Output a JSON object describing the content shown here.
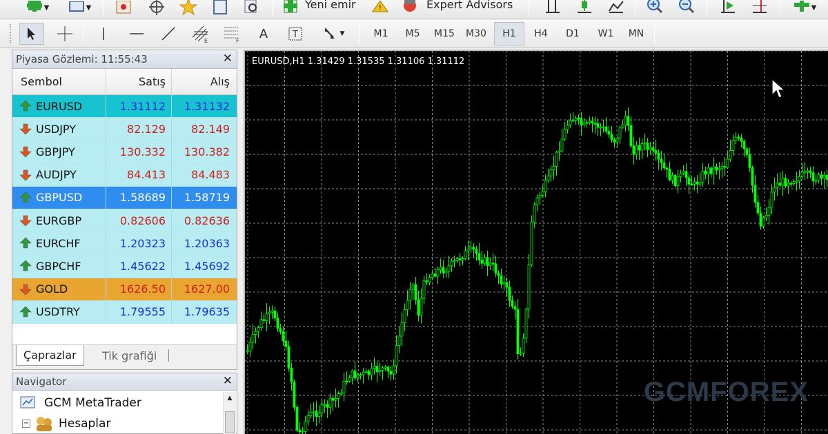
{
  "toolbar": {
    "new_order_label": "Yeni emir",
    "expert_advisors_label": "Expert Advisors",
    "timeframes": [
      "M1",
      "M5",
      "M15",
      "M30",
      "H1",
      "H4",
      "D1",
      "W1",
      "MN"
    ],
    "active_timeframe": "H1",
    "text_tool_label": "A"
  },
  "market_watch": {
    "title": "Piyasa Gözlemi: 11:55:43",
    "headers": {
      "symbol": "Sembol",
      "bid": "Satış",
      "ask": "Alış"
    },
    "rows": [
      {
        "symbol": "EURUSD",
        "bid": "1.31112",
        "ask": "1.31132",
        "direction": "up",
        "bg": "#17c3cf",
        "color": "#1530d0"
      },
      {
        "symbol": "USDJPY",
        "bid": "82.129",
        "ask": "82.149",
        "direction": "down",
        "bg": "#b7ecf3",
        "color": "#d0201a"
      },
      {
        "symbol": "GBPJPY",
        "bid": "130.332",
        "ask": "130.382",
        "direction": "down",
        "bg": "#b7ecf3",
        "color": "#d0201a"
      },
      {
        "symbol": "AUDJPY",
        "bid": "84.413",
        "ask": "84.483",
        "direction": "down",
        "bg": "#b7ecf3",
        "color": "#d0201a"
      },
      {
        "symbol": "GBPUSD",
        "bid": "1.58689",
        "ask": "1.58719",
        "direction": "up",
        "bg": "#2f8df0",
        "color": "#ffffff"
      },
      {
        "symbol": "EURGBP",
        "bid": "0.82606",
        "ask": "0.82636",
        "direction": "down",
        "bg": "#b7ecf3",
        "color": "#d0201a"
      },
      {
        "symbol": "EURCHF",
        "bid": "1.20323",
        "ask": "1.20363",
        "direction": "up",
        "bg": "#b7ecf3",
        "color": "#1530d0"
      },
      {
        "symbol": "GBPCHF",
        "bid": "1.45622",
        "ask": "1.45692",
        "direction": "up",
        "bg": "#b7ecf3",
        "color": "#1530d0"
      },
      {
        "symbol": "GOLD",
        "bid": "1626.50",
        "ask": "1627.00",
        "direction": "down",
        "bg": "#e8a531",
        "color": "#d0201a"
      },
      {
        "symbol": "USDTRY",
        "bid": "1.79555",
        "ask": "1.79635",
        "direction": "up",
        "bg": "#b7ecf3",
        "color": "#1530d0"
      }
    ],
    "tabs": [
      "Çaprazlar",
      "Tik grafiği"
    ],
    "active_tab": "Çaprazlar"
  },
  "navigator": {
    "title": "Navigator",
    "items": [
      "GCM MetaTrader",
      "Hesaplar"
    ]
  },
  "chart": {
    "header": "EURUSD,H1  1.31429 1.31535 1.31106 1.31112",
    "watermark_part1": "GCM",
    "watermark_part2": "FOREX",
    "candle_color": "#00ff00",
    "grid_color": "#8a8a8a",
    "background": "#000000"
  }
}
